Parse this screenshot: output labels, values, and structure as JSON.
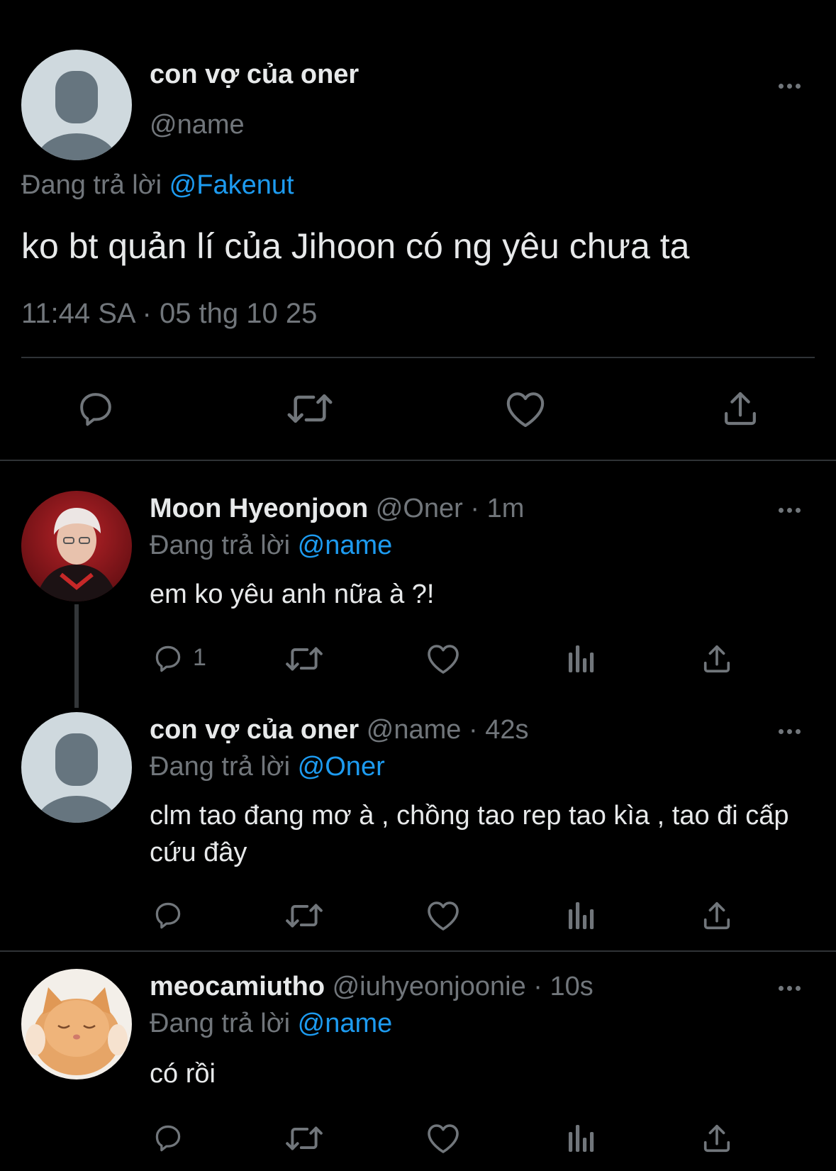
{
  "main_tweet": {
    "display_name": "con vợ của oner",
    "handle": "@name",
    "reply_prefix": "Đang trả lời",
    "reply_to": "@Fakenut",
    "text": "ko bt quản lí của Jihoon có ng yêu chưa ta",
    "timestamp": "11:44 SA · 05 thg 10 25"
  },
  "replies": [
    {
      "display_name": "Moon Hyeonjoon",
      "handle": "@Oner",
      "time": "· 1m",
      "reply_prefix": "Đang trả lời",
      "reply_to": "@name",
      "text": "em ko yêu anh nữa à ?!",
      "reply_count": "1"
    },
    {
      "display_name": "con vợ của oner",
      "handle": "@name",
      "time": "· 42s",
      "reply_prefix": "Đang trả lời",
      "reply_to": "@Oner",
      "text": "clm tao đang mơ à , chồng tao rep tao kìa , tao đi cấp cứu đây",
      "reply_count": ""
    },
    {
      "display_name": "meocamiutho",
      "handle": "@iuhyeonjoonie",
      "time": "· 10s",
      "reply_prefix": "Đang trả lời",
      "reply_to": "@name",
      "text": "có rồi",
      "reply_count": ""
    }
  ],
  "colors": {
    "background": "#000000",
    "text": "#e7e9ea",
    "muted": "#71767b",
    "link": "#1d9bf0",
    "divider": "#2f3336"
  },
  "icons": [
    "reply-icon",
    "retweet-icon",
    "like-icon",
    "views-icon",
    "share-icon",
    "more-icon"
  ]
}
